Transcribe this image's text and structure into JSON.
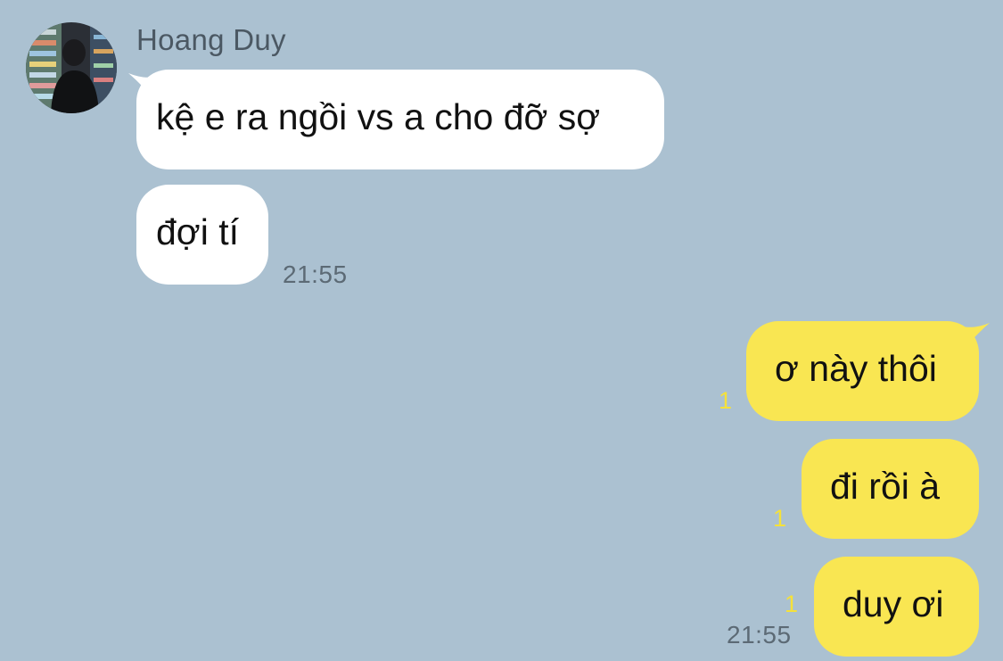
{
  "chat": {
    "sender_name": "Hoang Duy",
    "incoming": [
      {
        "text": "kệ e ra ngồi vs a cho đỡ sợ"
      },
      {
        "text": "đợi tí"
      }
    ],
    "incoming_time": "21:55",
    "outgoing": [
      {
        "text": "ơ này thôi",
        "unread": "1"
      },
      {
        "text": "đi rồi à",
        "unread": "1"
      },
      {
        "text": "duy ơi",
        "unread": "1"
      }
    ],
    "outgoing_time": "21:55"
  },
  "colors": {
    "background": "#abc1d1",
    "incoming_bubble": "#ffffff",
    "outgoing_bubble": "#f9e652",
    "unread_count": "#f5e13a",
    "timestamp": "#5c6a75"
  }
}
